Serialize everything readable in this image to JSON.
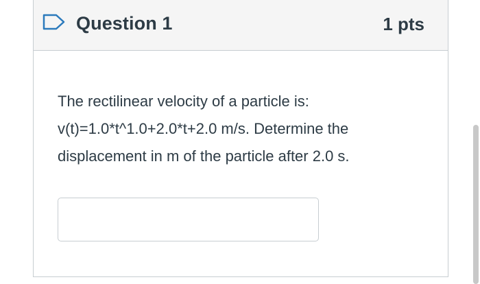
{
  "question": {
    "title": "Question 1",
    "points": "1 pts",
    "flag_icon": "flag-outline-icon",
    "text": "The rectilinear velocity of a particle is: v(t)=1.0*t^1.0+2.0*t+2.0 m/s. Determine the displacement in m of the particle after 2.0 s.",
    "answer": {
      "value": "",
      "placeholder": ""
    }
  },
  "colors": {
    "header_bg": "#f5f5f5",
    "border": "#c7cdd1",
    "flag_accent": "#2b7abc",
    "text": "#2d3b45"
  }
}
